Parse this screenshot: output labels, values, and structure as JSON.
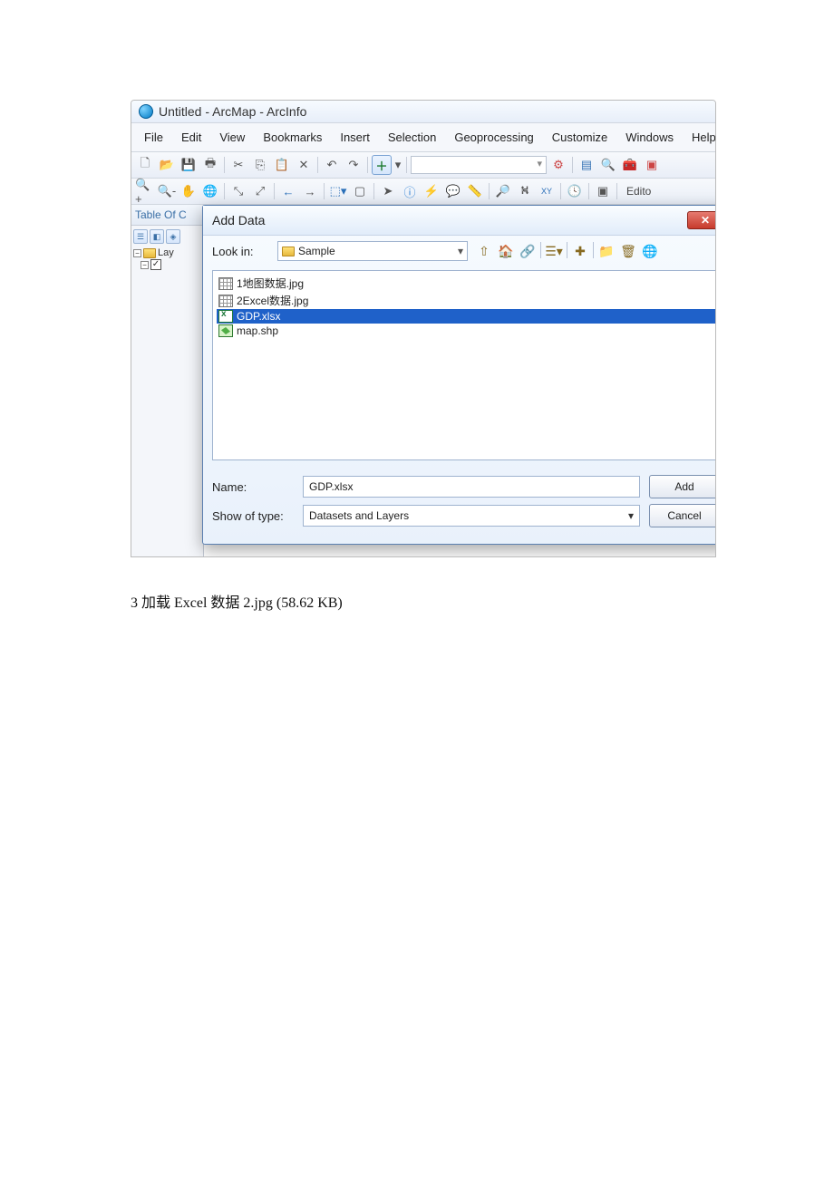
{
  "window": {
    "title": "Untitled - ArcMap - ArcInfo"
  },
  "menubar": [
    "File",
    "Edit",
    "View",
    "Bookmarks",
    "Insert",
    "Selection",
    "Geoprocessing",
    "Customize",
    "Windows",
    "Help"
  ],
  "editor_label": "Edito",
  "toc": {
    "title": "Table Of C",
    "layers_label": "Lay"
  },
  "dialog": {
    "title": "Add Data",
    "close_glyph": "✕",
    "lookin_label": "Look in:",
    "lookin_value": "Sample",
    "files": [
      {
        "name": "1地图数据.jpg",
        "type": "raster",
        "selected": false
      },
      {
        "name": "2Excel数据.jpg",
        "type": "raster",
        "selected": false
      },
      {
        "name": "GDP.xlsx",
        "type": "xls",
        "selected": true
      },
      {
        "name": "map.shp",
        "type": "shp",
        "selected": false
      }
    ],
    "name_label": "Name:",
    "name_value": "GDP.xlsx",
    "type_label": "Show of type:",
    "type_value": "Datasets and Layers",
    "add_label": "Add",
    "cancel_label": "Cancel"
  },
  "caption": "3 加载 Excel 数据 2.jpg (58.62 KB)"
}
